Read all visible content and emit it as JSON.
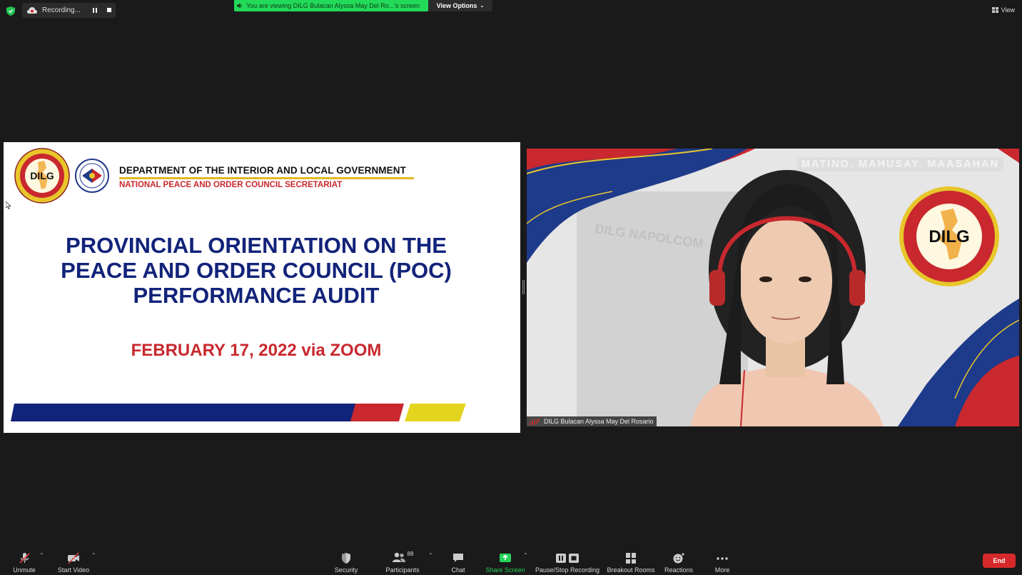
{
  "top": {
    "recording_label": "Recording...",
    "viewing_banner": "You are viewing DILG Bulacan Alyssa May Del Ro...'s screen",
    "view_options": "View Options",
    "view_label": "View"
  },
  "slide": {
    "dept_title": "DEPARTMENT OF THE INTERIOR AND LOCAL GOVERNMENT",
    "dept_sub": "NATIONAL PEACE AND ORDER COUNCIL SECRETARIAT",
    "seal_text": "DILG",
    "title_line1": "PROVINCIAL ORIENTATION ON THE",
    "title_line2": "PEACE AND ORDER COUNCIL (POC)",
    "title_line3": "PERFORMANCE AUDIT",
    "date": "FEBRUARY 17, 2022 via ZOOM"
  },
  "video": {
    "motto": "MATINO. MAHUSAY. MAASAHAN",
    "seal_text": "DILG",
    "participant_name": "DILG Bulacan Alyssa May Del Rosario"
  },
  "toolbar": {
    "unmute": "Unmute",
    "start_video": "Start Video",
    "security": "Security",
    "participants": "Participants",
    "participants_count": "88",
    "chat": "Chat",
    "share_screen": "Share Screen",
    "pause_stop_recording": "Pause/Stop Recording",
    "breakout_rooms": "Breakout Rooms",
    "reactions": "Reactions",
    "more": "More",
    "end": "End"
  },
  "colors": {
    "banner_green": "#23d959",
    "navy": "#12237a",
    "red": "#c8282e",
    "yellow": "#e3d420",
    "end_red": "#d6292b"
  }
}
